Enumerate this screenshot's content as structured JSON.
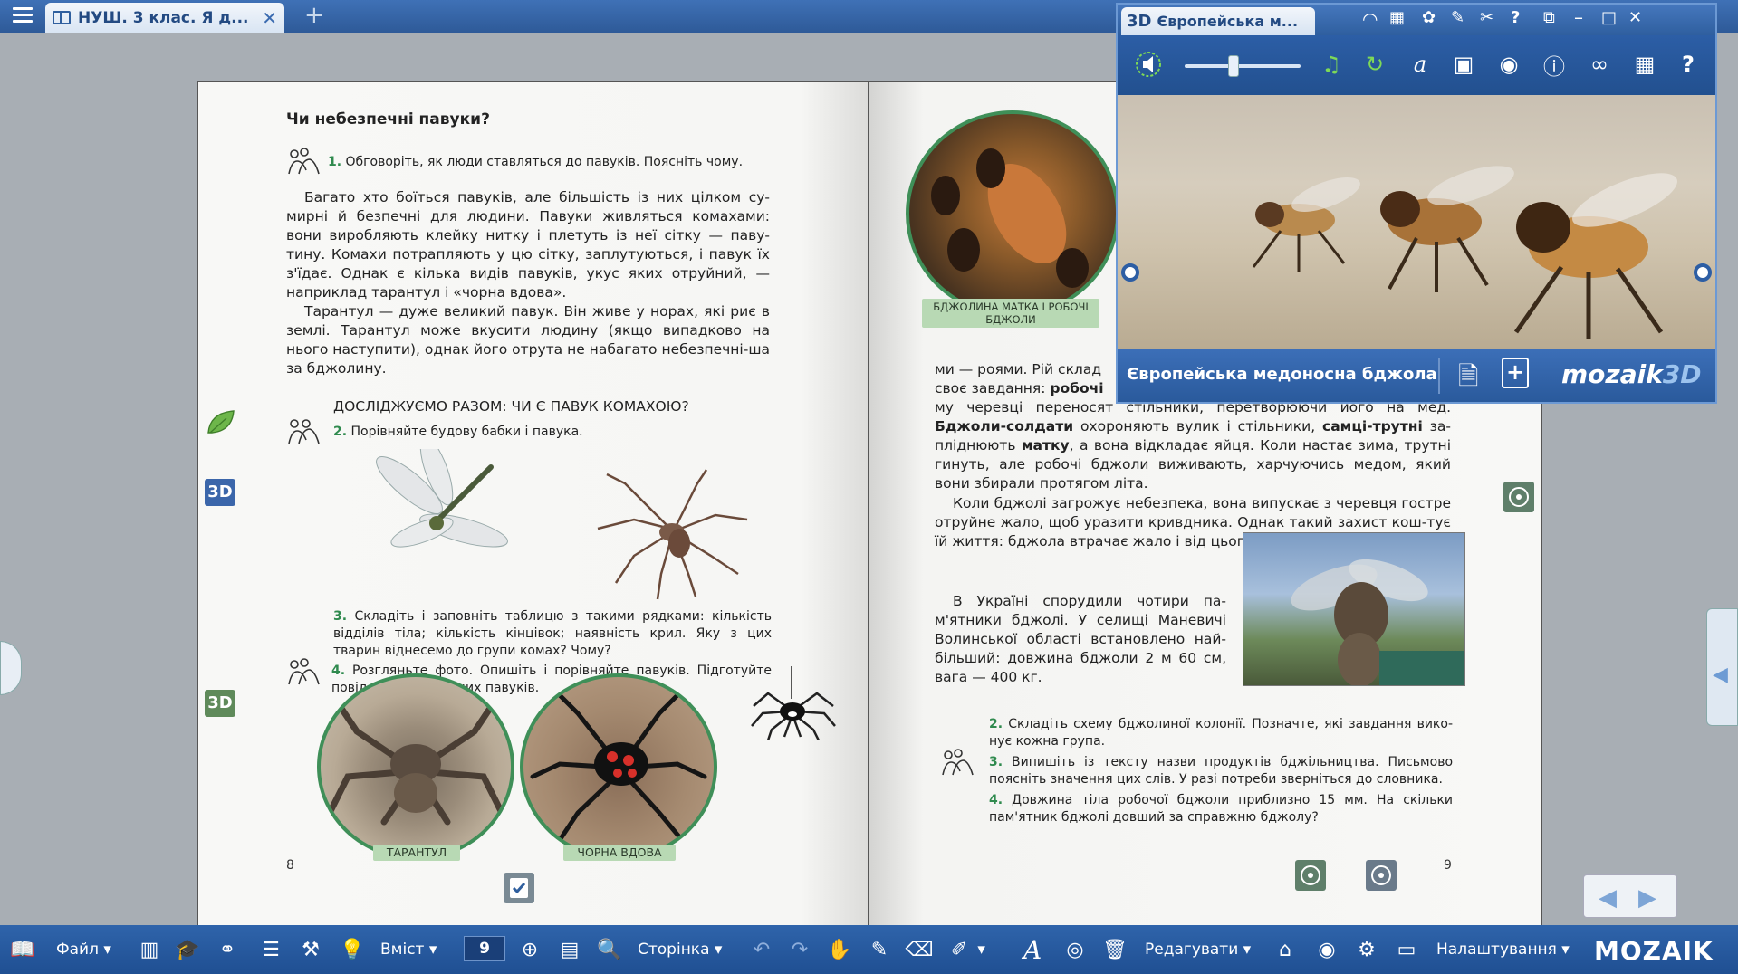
{
  "tab": {
    "title": "НУШ. 3 клас. Я д...",
    "close": "✕",
    "add": "+"
  },
  "left_page": {
    "heading": "Чи небезпечні павуки?",
    "task1_num": "1.",
    "task1_text": "Обговоріть, як люди ставляться до павуків. Поясніть чому.",
    "para1": "Багато хто боїться павуків, але більшість із них цілком су-мирні й безпечні для людини. Павуки живляться комахами: вони виробляють клейку нитку і плетуть із неї сітку — паву-тину. Комахи потрапляють у цю сітку, заплутуються, і павук їх з'їдає. Однак є кілька видів павуків, укус яких отруйний, — наприклад тарантул і «чорна вдова».",
    "para2": "Тарантул — дуже великий павук. Він живе у норах, які риє в землі. Тарантул може вкусити людину (якщо випадково на нього наступити), однак його отрута не набагато небезпечні-ша за бджолину.",
    "research_heading": "ДОСЛІДЖУЄМО РАЗОМ: ЧИ Є ПАВУК КОМАХОЮ?",
    "task2_num": "2.",
    "task2_text": "Порівняйте будову бабки і павука.",
    "task3_num": "3.",
    "task3_text": "Складіть і заповніть таблицю з такими рядками: кількість відділів тіла; кількість кінцівок; наявність крил. Яку з цих тварин віднесемо до групи комах? Чому?",
    "task4_num": "4.",
    "task4_text": "Розгляньте фото. Опишіть і порівняйте павуків. Підготуйте повідомлення про цих павуків.",
    "label_tarantula": "ТАРАНТУЛ",
    "label_widow": "ЧОРНА ВДОВА",
    "page_number": "8",
    "badge_3d_1": "3D",
    "badge_3d_2": "3D"
  },
  "right_page": {
    "label_queen": "БДЖОЛИНА МАТКА І РОБОЧІ БДЖОЛИ",
    "para1_a": "ми — роями. Рій склад",
    "para1_b": "своє завдання: ",
    "para1_bold1": "робочі",
    "para1_c": "му черевці переносят",
    "para1_d": " стільники, перетворюючи його на мед. ",
    "para1_bold2": "Бджоли-солдати",
    "para1_e": " охороняють вулик і стільники, ",
    "para1_bold3": "самці-трутні",
    "para1_f": " за-пліднюють ",
    "para1_bold4": "матку",
    "para1_g": ", а вона відкладає яйця. Коли настає зима, трутні гинуть, але робочі бджоли виживають, харчуючись медом, який вони збирали протягом літа.",
    "para2": "Коли бджолі загрожує небезпека, вона випускає з черевця гостре отруйне жало, щоб уразити кривдника. Однак такий захист кош-тує їй життя: бджола втрачає жало і від цього гине.",
    "para3": "В Україні спорудили чотири па-м'ятники бджолі. У селищі Маневичі Волинської області встановлено най-більший: довжина бджоли 2 м 60 см, вага — 400 кг.",
    "task2_num": "2.",
    "task2_text": "Складіть схему бджолиної колонії. Позначте, які завдання вико-нує кожна група.",
    "task3_num": "3.",
    "task3_text": "Випишіть із тексту назви продуктів бджільництва. Письмово поясніть значення цих слів. У разі потреби зверніться до словника.",
    "task4_num": "4.",
    "task4_text": "Довжина тіла робочої бджоли приблизно 15 мм. На скільки пам'ятник бджолі довший за справжню бджолу?",
    "page_number": "9"
  },
  "win3d": {
    "badge": "3D",
    "title": "Європейська м...",
    "model_name": "Європейська медоносна бджола",
    "brand_a": "mozaik",
    "brand_b": "3D",
    "volume_fraction": 0.42
  },
  "bottom": {
    "file": "Файл",
    "content": "Вміст",
    "page_value": "9",
    "page": "Сторінка",
    "edit": "Редагувати",
    "settings": "Налаштування",
    "logo": "MOZAIK"
  },
  "colors": {
    "accent": "#2f5f9e",
    "task_green": "#2f8a4e",
    "badge_3d": "#3b66aa",
    "badge_3d_green": "#5f8a5a"
  }
}
